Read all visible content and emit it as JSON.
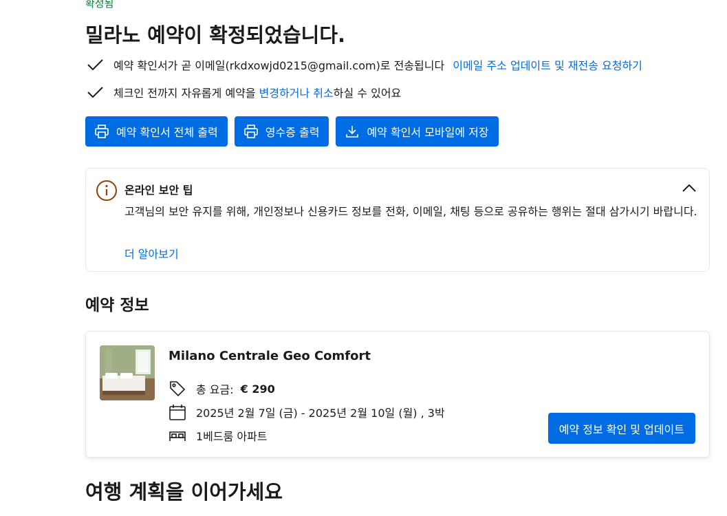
{
  "status": "확정됨",
  "title": "밀라노 예약이 확정되었습니다.",
  "checks": {
    "email_text": "예약 확인서가 곧 이메일(rkdxowjd0215@gmail.com)로 전송됩니다",
    "email_link": "이메일 주소 업데이트 및 재전송 요청하기",
    "change_prefix": "체크인 전까지 자유롭게 예약을",
    "change_link": "변경하거나 취소",
    "change_suffix": "하실 수 있어요"
  },
  "buttons": {
    "print_all": "예약 확인서 전체 출력",
    "print_receipt": "영수증 출력",
    "save_mobile": "예약 확인서 모바일에 저장"
  },
  "security_tip": {
    "title": "온라인 보안 팁",
    "body": "고객님의 보안 유지를 위해, 개인정보나 신용카드 정보를 전화, 이메일, 채팅 등으로 공유하는 행위는 절대 삼가시기 바랍니다.",
    "learn_more": "더 알아보기"
  },
  "reservation": {
    "section_title": "예약 정보",
    "hotel_name": "Milano Centrale Geo Comfort",
    "price_label": "총 요금:",
    "price_value": "€ 290",
    "dates": "2025년 2월 7일 (금) - 2025년 2월 10일 (월) , 3박",
    "room_type": "1베드룸 아파트",
    "update_button": "예약 정보 확인 및 업데이트"
  },
  "next_section_title": "여행 계획을 이어가세요",
  "colors": {
    "primary": "#006ce4",
    "success": "#008234",
    "info_icon": "#923e01"
  }
}
